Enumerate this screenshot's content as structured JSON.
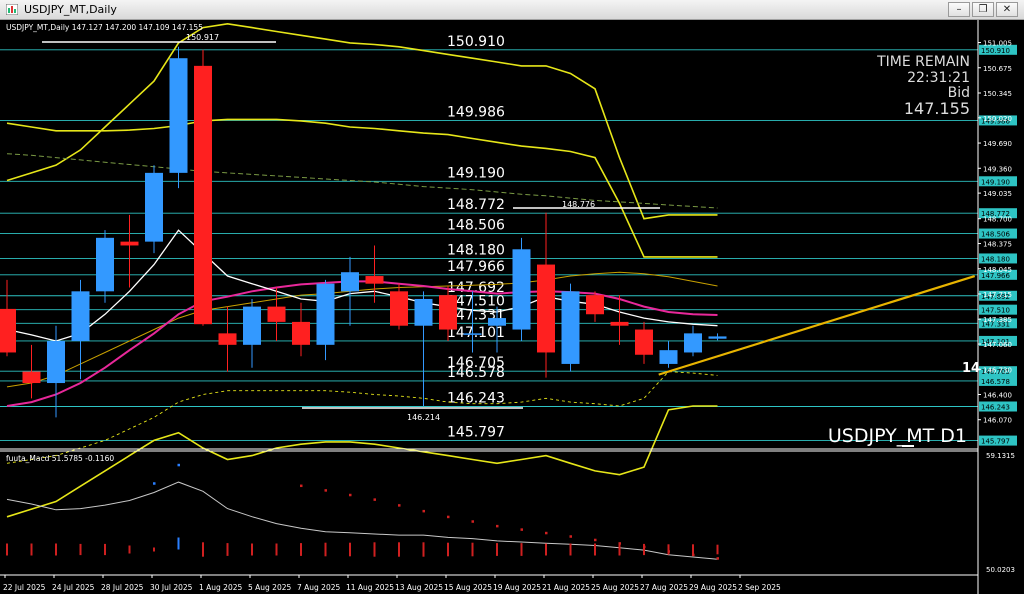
{
  "window": {
    "title": "USDJPY_MT,Daily",
    "controls": {
      "minimize": "–",
      "restore": "❐",
      "close": "✕"
    }
  },
  "header": {
    "symbol_info": "USDJPY_MT,Daily  147.127 147.200 147.109 147.155",
    "max_label": "150.917",
    "min_label": "146.214",
    "peak_label": "148.776"
  },
  "info_panel": {
    "time_remain_label": "TIME REMAIN",
    "time_remain": "22:31:21",
    "bid_label": "Bid",
    "bid_value": "147.155"
  },
  "watermark": "USDJPY_MT D1",
  "edge_mark": "14",
  "levels": [
    "150.910",
    "149.986",
    "149.190",
    "148.772",
    "148.506",
    "148.180",
    "147.966",
    "147.692",
    "147.510",
    "147.331",
    "147.101",
    "146.705",
    "146.578",
    "146.243",
    "145.797"
  ],
  "price_axis": {
    "ticks": [
      "151.005",
      "150.675",
      "150.345",
      "150.020",
      "149.690",
      "149.360",
      "149.035",
      "148.700",
      "148.375",
      "148.045",
      "147.715",
      "147.385",
      "147.060",
      "146.730",
      "146.400",
      "146.070"
    ],
    "tags": [
      "150.910",
      "149.986",
      "149.190",
      "148.772",
      "148.506",
      "148.180",
      "147.966",
      "147.692",
      "147.510",
      "147.331",
      "147.101",
      "146.705",
      "146.578",
      "146.243",
      "145.797"
    ]
  },
  "indicator": {
    "label": "fuuta_Macd 51.5785 -0.1160",
    "axis_top": "59.1315",
    "axis_bottom": "50.0203"
  },
  "date_labels": [
    "22 Jul 2025",
    "24 Jul 2025",
    "28 Jul 2025",
    "30 Jul 2025",
    "1 Aug 2025",
    "5 Aug 2025",
    "7 Aug 2025",
    "11 Aug 2025",
    "13 Aug 2025",
    "15 Aug 2025",
    "19 Aug 2025",
    "21 Aug 2025",
    "25 Aug 2025",
    "27 Aug 2025",
    "29 Aug 2025",
    "2 Sep 2025"
  ],
  "colors": {
    "bull": "#3399ff",
    "bear": "#ff2020",
    "level": "#2ec4c4",
    "bands": "#e6e619",
    "ma_pink": "#e8289a",
    "ma_white": "#ffffff",
    "ma_orange": "#c8a000",
    "trend": "#e8b400",
    "macd_line": "#c8c8c8",
    "hist_neg": "#d02020",
    "hist_pos": "#2a7fff"
  },
  "chart_data": {
    "type": "candlestick",
    "candles": [
      {
        "o": 147.52,
        "h": 147.9,
        "l": 146.9,
        "c": 146.95
      },
      {
        "o": 146.7,
        "h": 147.05,
        "l": 146.35,
        "c": 146.55
      },
      {
        "o": 146.55,
        "h": 147.3,
        "l": 146.1,
        "c": 147.1
      },
      {
        "o": 147.1,
        "h": 147.9,
        "l": 146.6,
        "c": 147.75
      },
      {
        "o": 147.75,
        "h": 148.55,
        "l": 147.6,
        "c": 148.45
      },
      {
        "o": 148.4,
        "h": 148.75,
        "l": 147.8,
        "c": 148.35
      },
      {
        "o": 148.4,
        "h": 149.4,
        "l": 148.25,
        "c": 149.3
      },
      {
        "o": 149.3,
        "h": 150.95,
        "l": 149.1,
        "c": 150.8
      },
      {
        "o": 150.7,
        "h": 150.91,
        "l": 147.3,
        "c": 147.32
      },
      {
        "o": 147.2,
        "h": 147.55,
        "l": 146.7,
        "c": 147.05
      },
      {
        "o": 147.05,
        "h": 147.65,
        "l": 146.75,
        "c": 147.55
      },
      {
        "o": 147.55,
        "h": 147.8,
        "l": 147.1,
        "c": 147.35
      },
      {
        "o": 147.35,
        "h": 147.6,
        "l": 146.9,
        "c": 147.05
      },
      {
        "o": 147.05,
        "h": 147.9,
        "l": 146.85,
        "c": 147.85
      },
      {
        "o": 147.75,
        "h": 148.2,
        "l": 147.3,
        "c": 148.0
      },
      {
        "o": 147.95,
        "h": 148.35,
        "l": 147.6,
        "c": 147.85
      },
      {
        "o": 147.75,
        "h": 147.85,
        "l": 147.25,
        "c": 147.3
      },
      {
        "o": 147.3,
        "h": 147.75,
        "l": 146.25,
        "c": 147.65
      },
      {
        "o": 147.7,
        "h": 147.82,
        "l": 147.1,
        "c": 147.25
      },
      {
        "o": 147.2,
        "h": 147.75,
        "l": 146.95,
        "c": 147.2
      },
      {
        "o": 147.3,
        "h": 147.55,
        "l": 146.95,
        "c": 147.4
      },
      {
        "o": 147.25,
        "h": 148.45,
        "l": 147.1,
        "c": 148.3
      },
      {
        "o": 148.1,
        "h": 148.78,
        "l": 146.62,
        "c": 146.95
      },
      {
        "o": 146.8,
        "h": 147.85,
        "l": 146.7,
        "c": 147.75
      },
      {
        "o": 147.7,
        "h": 147.75,
        "l": 147.35,
        "c": 147.45
      },
      {
        "o": 147.35,
        "h": 147.7,
        "l": 147.05,
        "c": 147.3
      },
      {
        "o": 147.25,
        "h": 147.35,
        "l": 146.8,
        "c": 146.92
      },
      {
        "o": 146.8,
        "h": 147.1,
        "l": 146.75,
        "c": 146.98
      },
      {
        "o": 146.95,
        "h": 147.3,
        "l": 146.9,
        "c": 147.2
      },
      {
        "o": 147.13,
        "h": 147.2,
        "l": 147.11,
        "c": 147.16
      }
    ],
    "levels": [
      150.91,
      149.986,
      149.19,
      148.772,
      148.506,
      148.18,
      147.966,
      147.692,
      147.51,
      147.331,
      147.101,
      146.705,
      146.578,
      146.243,
      145.797
    ],
    "price_range": [
      145.7,
      151.3
    ],
    "ma_white": [
      147.25,
      147.18,
      147.1,
      147.2,
      147.45,
      147.75,
      148.1,
      148.55,
      148.25,
      147.95,
      147.85,
      147.75,
      147.65,
      147.62,
      147.72,
      147.75,
      147.68,
      147.6,
      147.55,
      147.5,
      147.48,
      147.55,
      147.68,
      147.62,
      147.58,
      147.48,
      147.4,
      147.35,
      147.32,
      147.3
    ],
    "ma_pink": [
      146.25,
      146.3,
      146.4,
      146.55,
      146.75,
      146.98,
      147.2,
      147.45,
      147.62,
      147.68,
      147.75,
      147.8,
      147.84,
      147.86,
      147.88,
      147.88,
      147.85,
      147.82,
      147.78,
      147.75,
      147.72,
      147.74,
      147.75,
      147.74,
      147.72,
      147.65,
      147.55,
      147.48,
      147.45,
      147.44
    ],
    "ma_orange": [
      146.5,
      146.55,
      146.65,
      146.8,
      146.95,
      147.1,
      147.25,
      147.4,
      147.5,
      147.55,
      147.6,
      147.65,
      147.7,
      147.72,
      147.75,
      147.78,
      147.8,
      147.81,
      147.82,
      147.83,
      147.84,
      147.86,
      147.9,
      147.95,
      147.98,
      148.0,
      147.98,
      147.94,
      147.88,
      147.82
    ],
    "ma_green": [
      149.55,
      149.53,
      149.5,
      149.47,
      149.44,
      149.41,
      149.38,
      149.35,
      149.32,
      149.3,
      149.28,
      149.26,
      149.24,
      149.22,
      149.2,
      149.18,
      149.15,
      149.12,
      149.1,
      149.08,
      149.05,
      149.02,
      149.0,
      148.97,
      148.94,
      148.92,
      148.9,
      148.88,
      148.86,
      148.84
    ],
    "band_upper": [
      149.2,
      149.3,
      149.4,
      149.6,
      149.9,
      150.2,
      150.5,
      151.0,
      151.2,
      151.25,
      151.2,
      151.15,
      151.1,
      151.05,
      151.0,
      150.98,
      150.95,
      150.9,
      150.85,
      150.8,
      150.75,
      150.7,
      150.7,
      150.6,
      150.4,
      149.5,
      148.7,
      148.75,
      148.75,
      148.75
    ],
    "band_mid": [
      149.95,
      149.9,
      149.85,
      149.85,
      149.85,
      149.86,
      149.88,
      149.92,
      149.98,
      150.0,
      150.0,
      150.0,
      149.98,
      149.95,
      149.9,
      149.88,
      149.85,
      149.82,
      149.8,
      149.75,
      149.7,
      149.65,
      149.62,
      149.58,
      149.5,
      148.9,
      148.2,
      148.2,
      148.2,
      148.2
    ],
    "band_lower": [
      144.8,
      144.9,
      145.0,
      145.2,
      145.4,
      145.6,
      145.8,
      145.9,
      145.7,
      145.55,
      145.6,
      145.7,
      145.75,
      145.78,
      145.78,
      145.75,
      145.7,
      145.65,
      145.6,
      145.55,
      145.5,
      145.55,
      145.6,
      145.5,
      145.4,
      145.35,
      145.45,
      146.2,
      146.25,
      146.25
    ],
    "band_lower2": [
      145.5,
      145.55,
      145.6,
      145.7,
      145.8,
      145.95,
      146.1,
      146.3,
      146.4,
      146.45,
      146.45,
      146.45,
      146.45,
      146.45,
      146.43,
      146.4,
      146.38,
      146.35,
      146.3,
      146.28,
      146.28,
      146.3,
      146.35,
      146.3,
      146.28,
      146.25,
      146.35,
      146.7,
      146.68,
      146.65
    ],
    "trendline": [
      [
        26.6,
        146.66
      ],
      [
        39.5,
        147.95
      ]
    ],
    "macd_line": [
      55.8,
      55.4,
      54.9,
      55.0,
      55.3,
      55.7,
      56.4,
      57.3,
      56.5,
      55.0,
      54.3,
      53.7,
      53.3,
      53.0,
      52.9,
      52.8,
      52.7,
      52.7,
      52.5,
      52.4,
      52.2,
      52.1,
      52.0,
      51.9,
      51.8,
      51.6,
      51.4,
      51.0,
      50.8,
      50.6
    ],
    "macd_signal": [
      null,
      null,
      null,
      null,
      null,
      null,
      57.2,
      58.8,
      null,
      null,
      null,
      null,
      57.0,
      56.6,
      56.2,
      55.8,
      55.3,
      54.8,
      54.3,
      53.9,
      53.5,
      53.2,
      52.9,
      52.6,
      52.3,
      52.0,
      51.7,
      51.3,
      51.0,
      50.7
    ],
    "macd_hist": [
      -1.5,
      -1.5,
      -1.5,
      -1.4,
      -1.4,
      -1.0,
      -0.5,
      1.5,
      -1.8,
      -1.6,
      -1.5,
      -1.5,
      -1.6,
      -1.7,
      -1.7,
      -1.8,
      -1.8,
      -1.8,
      -1.7,
      -1.7,
      -1.6,
      -1.6,
      -1.5,
      -1.5,
      -1.5,
      -1.5,
      -1.4,
      -1.3,
      -1.3,
      -1.2
    ],
    "macd_range": [
      50.02,
      59.13
    ]
  }
}
